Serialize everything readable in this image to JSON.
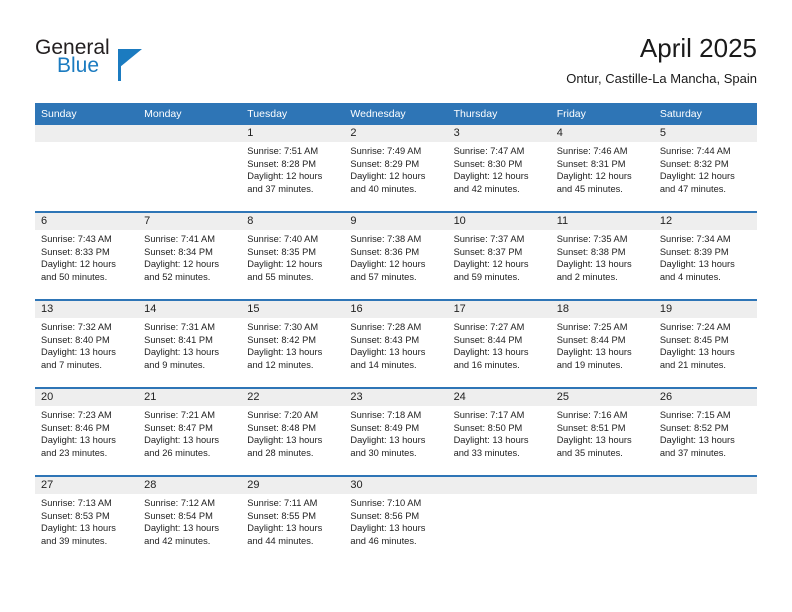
{
  "brand": {
    "name_top": "General",
    "name_bottom": "Blue",
    "accent_color": "#1b7bc0"
  },
  "header": {
    "title": "April 2025",
    "subtitle": "Ontur, Castille-La Mancha, Spain"
  },
  "theme": {
    "header_blue": "#2e75b6",
    "daynum_band": "#eeeeee",
    "text": "#222222"
  },
  "weekday_headers": [
    "Sunday",
    "Monday",
    "Tuesday",
    "Wednesday",
    "Thursday",
    "Friday",
    "Saturday"
  ],
  "weeks": [
    [
      {
        "day": "",
        "lines": []
      },
      {
        "day": "",
        "lines": []
      },
      {
        "day": "1",
        "lines": [
          "Sunrise: 7:51 AM",
          "Sunset: 8:28 PM",
          "Daylight: 12 hours",
          "and 37 minutes."
        ]
      },
      {
        "day": "2",
        "lines": [
          "Sunrise: 7:49 AM",
          "Sunset: 8:29 PM",
          "Daylight: 12 hours",
          "and 40 minutes."
        ]
      },
      {
        "day": "3",
        "lines": [
          "Sunrise: 7:47 AM",
          "Sunset: 8:30 PM",
          "Daylight: 12 hours",
          "and 42 minutes."
        ]
      },
      {
        "day": "4",
        "lines": [
          "Sunrise: 7:46 AM",
          "Sunset: 8:31 PM",
          "Daylight: 12 hours",
          "and 45 minutes."
        ]
      },
      {
        "day": "5",
        "lines": [
          "Sunrise: 7:44 AM",
          "Sunset: 8:32 PM",
          "Daylight: 12 hours",
          "and 47 minutes."
        ]
      }
    ],
    [
      {
        "day": "6",
        "lines": [
          "Sunrise: 7:43 AM",
          "Sunset: 8:33 PM",
          "Daylight: 12 hours",
          "and 50 minutes."
        ]
      },
      {
        "day": "7",
        "lines": [
          "Sunrise: 7:41 AM",
          "Sunset: 8:34 PM",
          "Daylight: 12 hours",
          "and 52 minutes."
        ]
      },
      {
        "day": "8",
        "lines": [
          "Sunrise: 7:40 AM",
          "Sunset: 8:35 PM",
          "Daylight: 12 hours",
          "and 55 minutes."
        ]
      },
      {
        "day": "9",
        "lines": [
          "Sunrise: 7:38 AM",
          "Sunset: 8:36 PM",
          "Daylight: 12 hours",
          "and 57 minutes."
        ]
      },
      {
        "day": "10",
        "lines": [
          "Sunrise: 7:37 AM",
          "Sunset: 8:37 PM",
          "Daylight: 12 hours",
          "and 59 minutes."
        ]
      },
      {
        "day": "11",
        "lines": [
          "Sunrise: 7:35 AM",
          "Sunset: 8:38 PM",
          "Daylight: 13 hours",
          "and 2 minutes."
        ]
      },
      {
        "day": "12",
        "lines": [
          "Sunrise: 7:34 AM",
          "Sunset: 8:39 PM",
          "Daylight: 13 hours",
          "and 4 minutes."
        ]
      }
    ],
    [
      {
        "day": "13",
        "lines": [
          "Sunrise: 7:32 AM",
          "Sunset: 8:40 PM",
          "Daylight: 13 hours",
          "and 7 minutes."
        ]
      },
      {
        "day": "14",
        "lines": [
          "Sunrise: 7:31 AM",
          "Sunset: 8:41 PM",
          "Daylight: 13 hours",
          "and 9 minutes."
        ]
      },
      {
        "day": "15",
        "lines": [
          "Sunrise: 7:30 AM",
          "Sunset: 8:42 PM",
          "Daylight: 13 hours",
          "and 12 minutes."
        ]
      },
      {
        "day": "16",
        "lines": [
          "Sunrise: 7:28 AM",
          "Sunset: 8:43 PM",
          "Daylight: 13 hours",
          "and 14 minutes."
        ]
      },
      {
        "day": "17",
        "lines": [
          "Sunrise: 7:27 AM",
          "Sunset: 8:44 PM",
          "Daylight: 13 hours",
          "and 16 minutes."
        ]
      },
      {
        "day": "18",
        "lines": [
          "Sunrise: 7:25 AM",
          "Sunset: 8:44 PM",
          "Daylight: 13 hours",
          "and 19 minutes."
        ]
      },
      {
        "day": "19",
        "lines": [
          "Sunrise: 7:24 AM",
          "Sunset: 8:45 PM",
          "Daylight: 13 hours",
          "and 21 minutes."
        ]
      }
    ],
    [
      {
        "day": "20",
        "lines": [
          "Sunrise: 7:23 AM",
          "Sunset: 8:46 PM",
          "Daylight: 13 hours",
          "and 23 minutes."
        ]
      },
      {
        "day": "21",
        "lines": [
          "Sunrise: 7:21 AM",
          "Sunset: 8:47 PM",
          "Daylight: 13 hours",
          "and 26 minutes."
        ]
      },
      {
        "day": "22",
        "lines": [
          "Sunrise: 7:20 AM",
          "Sunset: 8:48 PM",
          "Daylight: 13 hours",
          "and 28 minutes."
        ]
      },
      {
        "day": "23",
        "lines": [
          "Sunrise: 7:18 AM",
          "Sunset: 8:49 PM",
          "Daylight: 13 hours",
          "and 30 minutes."
        ]
      },
      {
        "day": "24",
        "lines": [
          "Sunrise: 7:17 AM",
          "Sunset: 8:50 PM",
          "Daylight: 13 hours",
          "and 33 minutes."
        ]
      },
      {
        "day": "25",
        "lines": [
          "Sunrise: 7:16 AM",
          "Sunset: 8:51 PM",
          "Daylight: 13 hours",
          "and 35 minutes."
        ]
      },
      {
        "day": "26",
        "lines": [
          "Sunrise: 7:15 AM",
          "Sunset: 8:52 PM",
          "Daylight: 13 hours",
          "and 37 minutes."
        ]
      }
    ],
    [
      {
        "day": "27",
        "lines": [
          "Sunrise: 7:13 AM",
          "Sunset: 8:53 PM",
          "Daylight: 13 hours",
          "and 39 minutes."
        ]
      },
      {
        "day": "28",
        "lines": [
          "Sunrise: 7:12 AM",
          "Sunset: 8:54 PM",
          "Daylight: 13 hours",
          "and 42 minutes."
        ]
      },
      {
        "day": "29",
        "lines": [
          "Sunrise: 7:11 AM",
          "Sunset: 8:55 PM",
          "Daylight: 13 hours",
          "and 44 minutes."
        ]
      },
      {
        "day": "30",
        "lines": [
          "Sunrise: 7:10 AM",
          "Sunset: 8:56 PM",
          "Daylight: 13 hours",
          "and 46 minutes."
        ]
      },
      {
        "day": "",
        "lines": []
      },
      {
        "day": "",
        "lines": []
      },
      {
        "day": "",
        "lines": []
      }
    ]
  ]
}
